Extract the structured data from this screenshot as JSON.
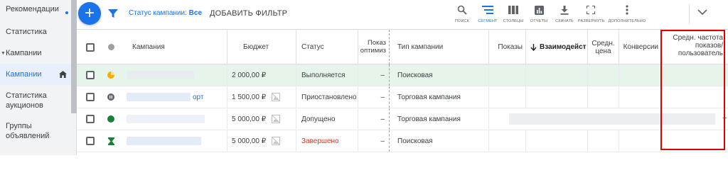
{
  "sidebar": {
    "items": [
      {
        "label": "Рекомендации"
      },
      {
        "label": "Статистика"
      },
      {
        "label": "Кампании"
      },
      {
        "label": "Кампании"
      },
      {
        "label": "Статистика аукционов"
      },
      {
        "label": "Группы объявлений"
      }
    ]
  },
  "toolbar": {
    "add_symbol": "+",
    "status_prefix": "Статус кампании: ",
    "status_value": "Все",
    "add_filter": "ДОБАВИТЬ ФИЛЬТР",
    "buttons": [
      {
        "label": "ПОИСК",
        "icon": "search-icon"
      },
      {
        "label": "СЕГМЕНТ",
        "icon": "segment-icon"
      },
      {
        "label": "СТОЛБЦЫ",
        "icon": "columns-icon"
      },
      {
        "label": "ОТЧЕТЫ",
        "icon": "reports-icon"
      },
      {
        "label": "СКАЧАТЬ",
        "icon": "download-icon"
      },
      {
        "label": "РАЗВЕРНУТЬ",
        "icon": "expand-icon"
      },
      {
        "label": "ДОПОЛНИТЕЛЬНО",
        "icon": "more-icon"
      }
    ]
  },
  "table": {
    "headers": {
      "campaign": "Кампания",
      "budget": "Бюджет",
      "status": "Статус",
      "optim": "Показ оптимиз",
      "type": "Тип кампании",
      "impressions": "Показы",
      "interactions": "Взаимодейст",
      "avg_price": "Средн. цена",
      "conversions": "Конверсии",
      "freq": "Средн. частота показов/ пользователь"
    },
    "rows": [
      {
        "campaign": "",
        "budget": "2 000,00 ₽",
        "status": "Выполняется",
        "optim": "–",
        "type": "Поисковая",
        "status_icon": "paused-pie-icon"
      },
      {
        "campaign": "орт",
        "budget": "1 500,00 ₽",
        "status": "Приостановлено",
        "optim": "–",
        "type": "Торговая кампания",
        "status_icon": "paused-icon"
      },
      {
        "campaign": "",
        "budget": "5 000,00 ₽",
        "status": "Допущено",
        "optim": "–",
        "type": "Торговая кампания",
        "status_icon": "eligible-dot-icon",
        "freq": "–"
      },
      {
        "campaign": "",
        "budget": "5 000,00 ₽",
        "status": "Завершено",
        "optim": "–",
        "type": "Поисковая",
        "status_icon": "ended-hourglass-icon"
      }
    ]
  },
  "colors": {
    "accent": "#1a73e8",
    "selected_row": "#e6f4ea",
    "highlight": "#e00000",
    "status_green": "#188038",
    "status_orange": "#f9ab00",
    "status_red": "#d93025"
  }
}
